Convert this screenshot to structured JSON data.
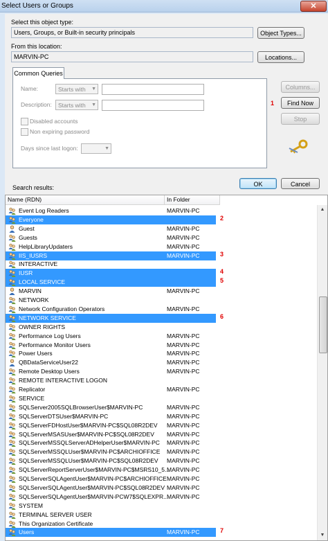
{
  "window": {
    "title": "Select Users or Groups",
    "close_label": "✕"
  },
  "object_type": {
    "label": "Select this object type:",
    "value": "Users, Groups, or Built-in security principals",
    "button": "Object Types..."
  },
  "location": {
    "label": "From this location:",
    "value": "MARVIN-PC",
    "button": "Locations..."
  },
  "queries": {
    "tab_label": "Common Queries",
    "name_label": "Name:",
    "name_mode": "Starts with",
    "description_label": "Description:",
    "description_mode": "Starts with",
    "disabled_accounts": "Disabled accounts",
    "non_expiring": "Non expiring password",
    "days_since_logon": "Days since last logon:",
    "columns_button": "Columns...",
    "find_now_button": "Find Now",
    "stop_button": "Stop"
  },
  "actions": {
    "ok": "OK",
    "cancel": "Cancel"
  },
  "results": {
    "label": "Search results:",
    "columns": [
      "Name (RDN)",
      "In Folder"
    ],
    "rows": [
      {
        "name": "Event Log Readers",
        "folder": "MARVIN-PC",
        "icon": "group-icon",
        "selected": false
      },
      {
        "name": "Everyone",
        "folder": "",
        "icon": "group-icon",
        "selected": true
      },
      {
        "name": "Guest",
        "folder": "MARVIN-PC",
        "icon": "user-icon",
        "selected": false
      },
      {
        "name": "Guests",
        "folder": "MARVIN-PC",
        "icon": "group-icon",
        "selected": false
      },
      {
        "name": "HelpLibraryUpdaters",
        "folder": "MARVIN-PC",
        "icon": "group-icon",
        "selected": false
      },
      {
        "name": "IIS_IUSRS",
        "folder": "MARVIN-PC",
        "icon": "group-icon",
        "selected": true
      },
      {
        "name": "INTERACTIVE",
        "folder": "",
        "icon": "group-icon",
        "selected": false
      },
      {
        "name": "IUSR",
        "folder": "",
        "icon": "group-icon",
        "selected": true
      },
      {
        "name": "LOCAL SERVICE",
        "folder": "",
        "icon": "group-icon",
        "selected": true
      },
      {
        "name": "MARVIN",
        "folder": "MARVIN-PC",
        "icon": "user-icon",
        "selected": false
      },
      {
        "name": "NETWORK",
        "folder": "",
        "icon": "group-icon",
        "selected": false
      },
      {
        "name": "Network Configuration Operators",
        "folder": "MARVIN-PC",
        "icon": "group-icon",
        "selected": false
      },
      {
        "name": "NETWORK SERVICE",
        "folder": "",
        "icon": "group-icon",
        "selected": true
      },
      {
        "name": "OWNER RIGHTS",
        "folder": "",
        "icon": "group-icon",
        "selected": false
      },
      {
        "name": "Performance Log Users",
        "folder": "MARVIN-PC",
        "icon": "group-icon",
        "selected": false
      },
      {
        "name": "Performance Monitor Users",
        "folder": "MARVIN-PC",
        "icon": "group-icon",
        "selected": false
      },
      {
        "name": "Power Users",
        "folder": "MARVIN-PC",
        "icon": "group-icon",
        "selected": false
      },
      {
        "name": "QBDataServiceUser22",
        "folder": "MARVIN-PC",
        "icon": "user-icon",
        "selected": false
      },
      {
        "name": "Remote Desktop Users",
        "folder": "MARVIN-PC",
        "icon": "group-icon",
        "selected": false
      },
      {
        "name": "REMOTE INTERACTIVE LOGON",
        "folder": "",
        "icon": "group-icon",
        "selected": false
      },
      {
        "name": "Replicator",
        "folder": "MARVIN-PC",
        "icon": "group-icon",
        "selected": false
      },
      {
        "name": "SERVICE",
        "folder": "",
        "icon": "group-icon",
        "selected": false
      },
      {
        "name": "SQLServer2005SQLBrowserUser$MARVIN-PC",
        "folder": "MARVIN-PC",
        "icon": "group-icon",
        "selected": false
      },
      {
        "name": "SQLServerDTSUser$MARVIN-PC",
        "folder": "MARVIN-PC",
        "icon": "group-icon",
        "selected": false
      },
      {
        "name": "SQLServerFDHostUser$MARVIN-PC$SQL08R2DEV",
        "folder": "MARVIN-PC",
        "icon": "group-icon",
        "selected": false
      },
      {
        "name": "SQLServerMSASUser$MARVIN-PC$SQL08R2DEV",
        "folder": "MARVIN-PC",
        "icon": "group-icon",
        "selected": false
      },
      {
        "name": "SQLServerMSSQLServerADHelperUser$MARVIN-PC",
        "folder": "MARVIN-PC",
        "icon": "group-icon",
        "selected": false
      },
      {
        "name": "SQLServerMSSQLUser$MARVIN-PC$ARCHIOFFICE",
        "folder": "MARVIN-PC",
        "icon": "group-icon",
        "selected": false
      },
      {
        "name": "SQLServerMSSQLUser$MARVIN-PC$SQL08R2DEV",
        "folder": "MARVIN-PC",
        "icon": "group-icon",
        "selected": false
      },
      {
        "name": "SQLServerReportServerUser$MARVIN-PC$MSRS10_5...",
        "folder": "MARVIN-PC",
        "icon": "group-icon",
        "selected": false
      },
      {
        "name": "SQLServerSQLAgentUser$MARVIN-PC$ARCHIOFFICE",
        "folder": "MARVIN-PC",
        "icon": "group-icon",
        "selected": false
      },
      {
        "name": "SQLServerSQLAgentUser$MARVIN-PC$SQL08R2DEV",
        "folder": "MARVIN-PC",
        "icon": "group-icon",
        "selected": false
      },
      {
        "name": "SQLServerSQLAgentUser$MARVIN-PCW7$SQLEXPR...",
        "folder": "MARVIN-PC",
        "icon": "group-icon",
        "selected": false
      },
      {
        "name": "SYSTEM",
        "folder": "",
        "icon": "group-icon",
        "selected": false
      },
      {
        "name": "TERMINAL SERVER USER",
        "folder": "",
        "icon": "group-icon",
        "selected": false
      },
      {
        "name": "This Organization Certificate",
        "folder": "",
        "icon": "group-icon",
        "selected": false
      },
      {
        "name": "Users",
        "folder": "MARVIN-PC",
        "icon": "group-icon",
        "selected": true
      }
    ]
  },
  "annotations": [
    {
      "label": "1",
      "anchor": "find_now"
    },
    {
      "label": "2",
      "row": 1
    },
    {
      "label": "3",
      "row": 5
    },
    {
      "label": "4",
      "row": 7
    },
    {
      "label": "5",
      "row": 8
    },
    {
      "label": "6",
      "row": 12
    },
    {
      "label": "7",
      "row": 36
    }
  ],
  "colors": {
    "selection": "#3399ff",
    "annotation": "#e00000"
  }
}
